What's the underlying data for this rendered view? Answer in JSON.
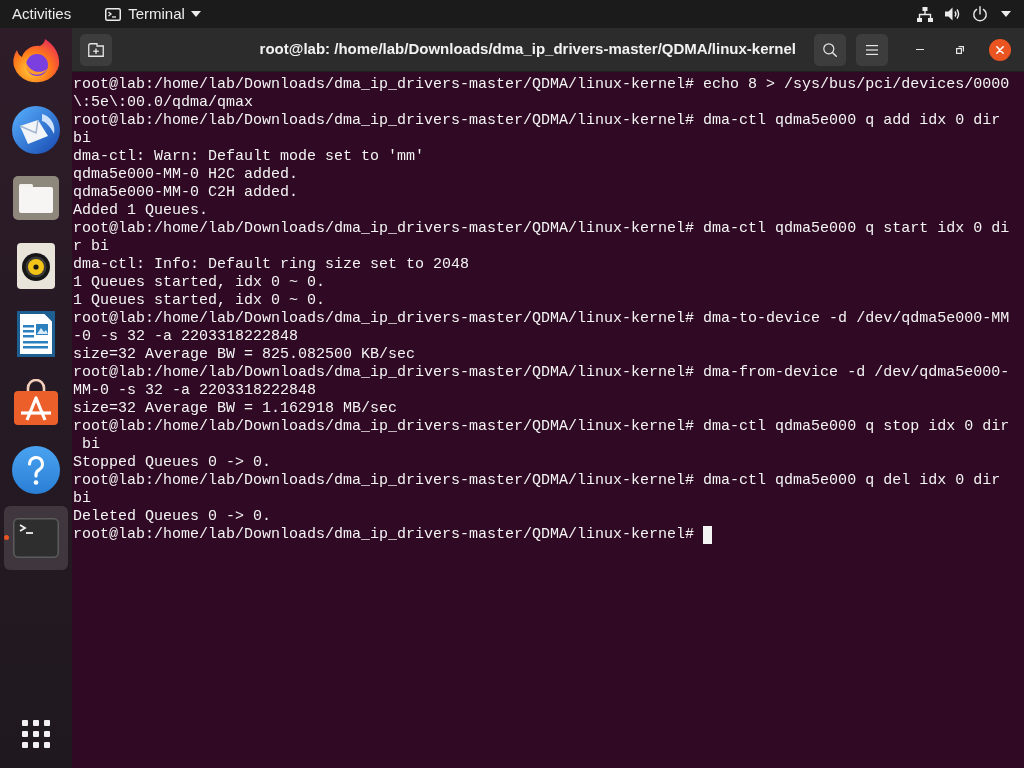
{
  "top_bar": {
    "activities": "Activities",
    "app_menu": {
      "label": "Terminal"
    }
  },
  "dock": {
    "items": [
      {
        "kind": "browser",
        "selected": false,
        "running": false
      },
      {
        "kind": "mail",
        "selected": false,
        "running": false
      },
      {
        "kind": "files",
        "selected": false,
        "running": false
      },
      {
        "kind": "music",
        "selected": false,
        "running": false
      },
      {
        "kind": "document",
        "selected": false,
        "running": false
      },
      {
        "kind": "software",
        "selected": false,
        "running": false
      },
      {
        "kind": "help",
        "selected": false,
        "running": false
      },
      {
        "kind": "terminal",
        "selected": true,
        "running": true
      }
    ]
  },
  "window": {
    "title": "root@lab: /home/lab/Downloads/dma_ip_drivers-master/QDMA/linux-kernel"
  },
  "terminal": {
    "lines": [
      "root@lab:/home/lab/Downloads/dma_ip_drivers-master/QDMA/linux-kernel# echo 8 > /sys/bus/pci/devices/0000",
      "\\:5e\\:00.0/qdma/qmax",
      "root@lab:/home/lab/Downloads/dma_ip_drivers-master/QDMA/linux-kernel# dma-ctl qdma5e000 q add idx 0 dir",
      "bi",
      "dma-ctl: Warn: Default mode set to 'mm'",
      "qdma5e000-MM-0 H2C added.",
      "qdma5e000-MM-0 C2H added.",
      "Added 1 Queues.",
      "root@lab:/home/lab/Downloads/dma_ip_drivers-master/QDMA/linux-kernel# dma-ctl qdma5e000 q start idx 0 di",
      "r bi",
      "dma-ctl: Info: Default ring size set to 2048",
      "1 Queues started, idx 0 ~ 0.",
      "1 Queues started, idx 0 ~ 0.",
      "root@lab:/home/lab/Downloads/dma_ip_drivers-master/QDMA/linux-kernel# dma-to-device -d /dev/qdma5e000-MM",
      "-0 -s 32 -a 2203318222848",
      "size=32 Average BW = 825.082500 KB/sec",
      "root@lab:/home/lab/Downloads/dma_ip_drivers-master/QDMA/linux-kernel# dma-from-device -d /dev/qdma5e000-",
      "MM-0 -s 32 -a 2203318222848",
      "size=32 Average BW = 1.162918 MB/sec",
      "root@lab:/home/lab/Downloads/dma_ip_drivers-master/QDMA/linux-kernel# dma-ctl qdma5e000 q stop idx 0 dir",
      " bi",
      "Stopped Queues 0 -> 0.",
      "root@lab:/home/lab/Downloads/dma_ip_drivers-master/QDMA/linux-kernel# dma-ctl qdma5e000 q del idx 0 dir",
      "bi",
      "Deleted Queues 0 -> 0."
    ],
    "input_line": {
      "text": "root@lab:/home/lab/Downloads/dma_ip_drivers-master/QDMA/linux-kernel#",
      "cursor": true
    }
  }
}
